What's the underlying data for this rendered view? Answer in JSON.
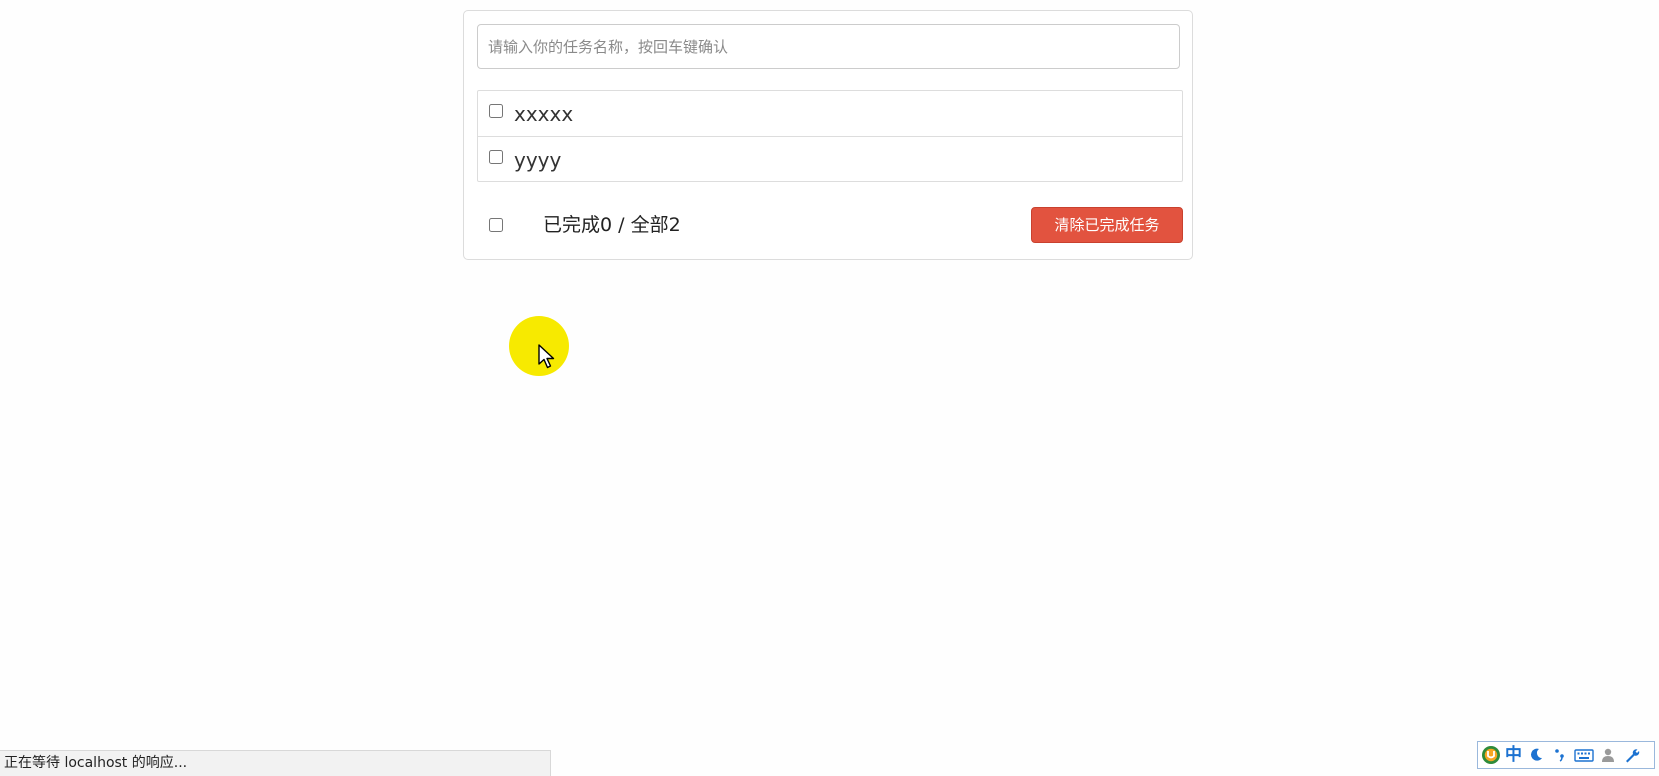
{
  "todo": {
    "input": {
      "placeholder": "请输入你的任务名称，按回车键确认",
      "value": ""
    },
    "tasks": [
      {
        "label": "xxxxx",
        "done": false
      },
      {
        "label": "yyyy",
        "done": false
      }
    ],
    "footer": {
      "stats_text": "已完成0 / 全部2",
      "clear_button_label": "清除已完成任务"
    }
  },
  "status_bar": {
    "text": "正在等待 localhost 的响应..."
  },
  "ime_toolbar": {
    "language": "中",
    "icons": [
      "ime-logo-icon",
      "moon-icon",
      "punctuation-icon",
      "keyboard-icon",
      "user-icon",
      "wrench-icon"
    ]
  },
  "colors": {
    "danger_button": "#e2533f",
    "cursor_highlight": "#f7ea00",
    "ime_accent": "#1c72d1"
  }
}
